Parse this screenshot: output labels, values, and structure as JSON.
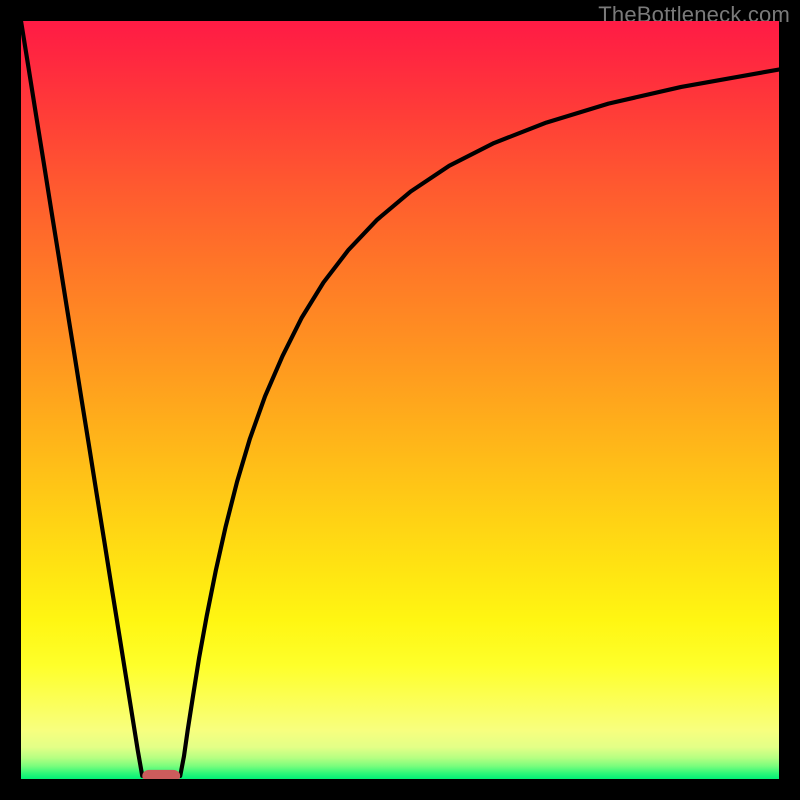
{
  "attribution": "TheBottleneck.com",
  "chart_data": {
    "type": "line",
    "title": "",
    "xlabel": "",
    "ylabel": "",
    "xlim": [
      0,
      100
    ],
    "ylim": [
      0,
      100
    ],
    "background_gradient": {
      "stops": [
        {
          "pos": 0.0,
          "color": "#ff1b45"
        },
        {
          "pos": 0.047,
          "color": "#ff2740"
        },
        {
          "pos": 0.12,
          "color": "#ff3c38"
        },
        {
          "pos": 0.22,
          "color": "#ff5a2f"
        },
        {
          "pos": 0.33,
          "color": "#ff7827"
        },
        {
          "pos": 0.44,
          "color": "#ff9520"
        },
        {
          "pos": 0.54,
          "color": "#ffb11a"
        },
        {
          "pos": 0.64,
          "color": "#ffcd15"
        },
        {
          "pos": 0.72,
          "color": "#ffe312"
        },
        {
          "pos": 0.79,
          "color": "#fff612"
        },
        {
          "pos": 0.85,
          "color": "#feff2a"
        },
        {
          "pos": 0.9,
          "color": "#fbff5a"
        },
        {
          "pos": 0.935,
          "color": "#f8ff7e"
        },
        {
          "pos": 0.958,
          "color": "#e3ff87"
        },
        {
          "pos": 0.972,
          "color": "#b6ff82"
        },
        {
          "pos": 0.983,
          "color": "#79fd7d"
        },
        {
          "pos": 0.992,
          "color": "#30f879"
        },
        {
          "pos": 1.0,
          "color": "#00f076"
        }
      ]
    },
    "series": [
      {
        "name": "left-branch",
        "x": [
          0.0,
          1.0,
          2.0,
          3.0,
          4.0,
          5.0,
          6.0,
          7.0,
          8.0,
          9.0,
          10.0,
          11.0,
          12.0,
          13.0,
          13.8,
          14.6,
          15.4,
          16.0
        ],
        "y": [
          100.0,
          93.8,
          87.5,
          81.3,
          75.0,
          68.8,
          62.5,
          56.3,
          50.0,
          43.8,
          37.5,
          31.3,
          25.0,
          18.8,
          13.8,
          8.8,
          3.8,
          0.4
        ]
      },
      {
        "name": "right-branch",
        "x": [
          21.0,
          21.5,
          22.0,
          22.7,
          23.5,
          24.5,
          25.7,
          27.0,
          28.5,
          30.2,
          32.2,
          34.5,
          37.0,
          39.9,
          43.2,
          47.0,
          51.4,
          56.5,
          62.4,
          69.3,
          77.5,
          87.1,
          100.0
        ],
        "y": [
          0.4,
          3.0,
          6.5,
          11.0,
          16.0,
          21.5,
          27.5,
          33.3,
          39.2,
          44.9,
          50.5,
          55.8,
          60.8,
          65.5,
          69.8,
          73.8,
          77.5,
          80.9,
          83.9,
          86.6,
          89.1,
          91.3,
          93.6
        ]
      }
    ],
    "marker": {
      "x_center": 18.5,
      "y": 0.4,
      "width": 5.0,
      "height": 1.6,
      "rx": 0.9,
      "color": "#cc5c5c"
    }
  }
}
